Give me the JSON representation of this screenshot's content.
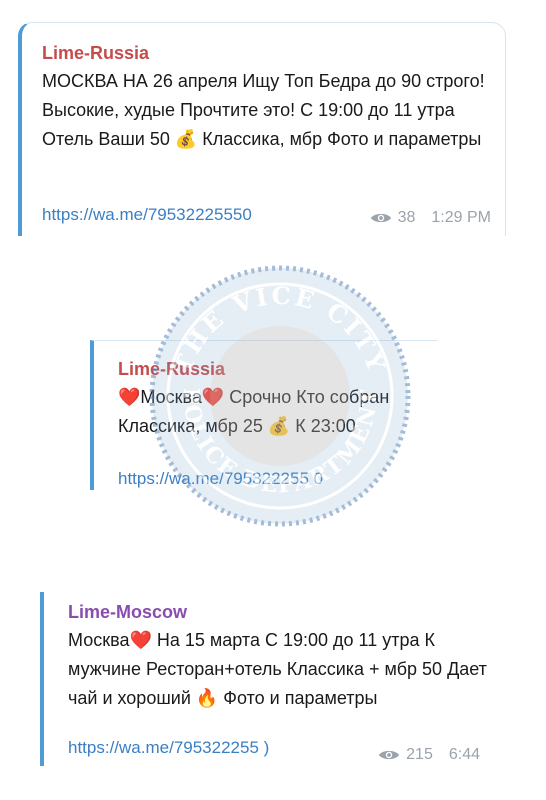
{
  "messages": [
    {
      "sender": "Lime-Russia",
      "text": "МОСКВА НА 26 апреля Ищу Топ Бедра до 90 строго! Высокие, худые Прочтите это! С 19:00 до 11 утра Отель Ваши 50 💰 Классика, мбр Фото и параметры",
      "link": "https://wa.me/79532225550",
      "views": "38",
      "time": "1:29 PM"
    },
    {
      "sender": "Lime-Russia",
      "text_line1": "❤️Москва❤️ Срочно Кто собран",
      "text_line2": "Классика, мбр 25 💰 К 23:00",
      "link": "https://wa.me/795322255 0"
    },
    {
      "sender": "Lime-Moscow",
      "text": "Москва❤️ На 15 марта С 19:00 до 11 утра К мужчине Ресторан+отель Классика + мбр 50 Дает чай и хороший 🔥 Фото и параметры",
      "link": "https://wa.me/795322255 )",
      "views": "215",
      "time": "6:44"
    }
  ],
  "watermark": {
    "top_text": "THE VICE CITY",
    "bottom_text": "POLICE DEPARTMENT"
  },
  "colors": {
    "accent_bar": "#4f9bd5",
    "sender_russia": "#c64b4b",
    "sender_moscow": "#8a4caf",
    "link": "#3a7fc4",
    "meta": "#9aa3ab"
  }
}
